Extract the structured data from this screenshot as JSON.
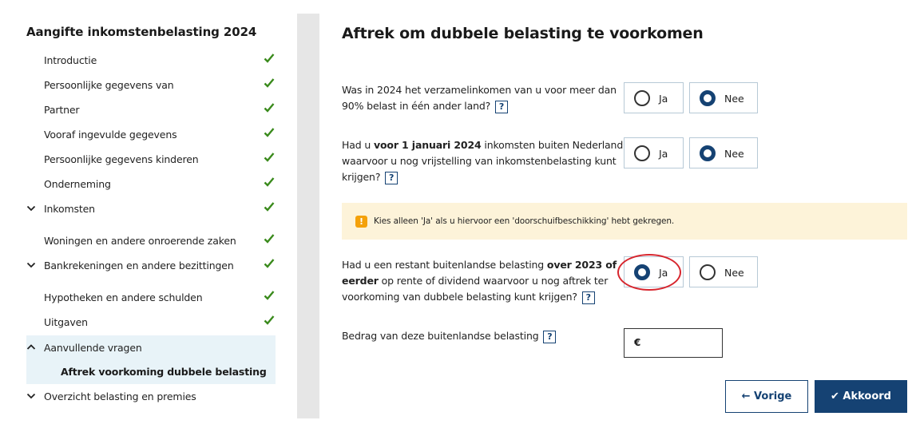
{
  "sidebar": {
    "title": "Aangifte inkomstenbelasting 2024",
    "items": [
      {
        "label": "Introductie"
      },
      {
        "label": "Persoonlijke gegevens van"
      },
      {
        "label": "Partner"
      },
      {
        "label": "Vooraf ingevulde gegevens"
      },
      {
        "label": "Persoonlijke gegevens kinderen"
      },
      {
        "label": "Onderneming"
      },
      {
        "label": "Inkomsten"
      },
      {
        "label": "Woningen en andere onroerende zaken"
      },
      {
        "label": "Bankrekeningen en andere bezittingen"
      },
      {
        "label": "Hypotheken en andere schulden"
      },
      {
        "label": "Uitgaven"
      },
      {
        "label": "Aanvullende vragen"
      },
      {
        "label": "Aftrek voorkoming dubbele belasting"
      },
      {
        "label": "Overzicht belasting en premies"
      }
    ]
  },
  "main": {
    "title": "Aftrek om dubbele belasting te voorkomen",
    "q1": {
      "line1": "Was in 2024 het verzamelinkomen van u voor meer dan",
      "line2": "90% belast in één ander land?"
    },
    "q2": {
      "pre": "Had u ",
      "bold": "voor 1 januari 2024",
      "post": " inkomsten buiten Nederland",
      "line2": "waarvoor u nog vrijstelling van inkomstenbelasting kunt",
      "line3": "krijgen?"
    },
    "notice": "Kies alleen 'Ja' als u hiervoor een 'doorschuifbeschikking' hebt gekregen.",
    "q3": {
      "pre": "Had u een restant buitenlandse belasting ",
      "bold1": "over 2023 of",
      "bold2": "eerder",
      "post2": " op rente of dividend waarvoor u nog aftrek ter",
      "line3": "voorkoming van dubbele belasting kunt krijgen?"
    },
    "q4": "Bedrag van deze buitenlandse belasting",
    "help": "?",
    "yes": "Ja",
    "no": "Nee",
    "currency": "€",
    "prev_button": "← Vorige",
    "ok_button": "✔ Akkoord"
  }
}
